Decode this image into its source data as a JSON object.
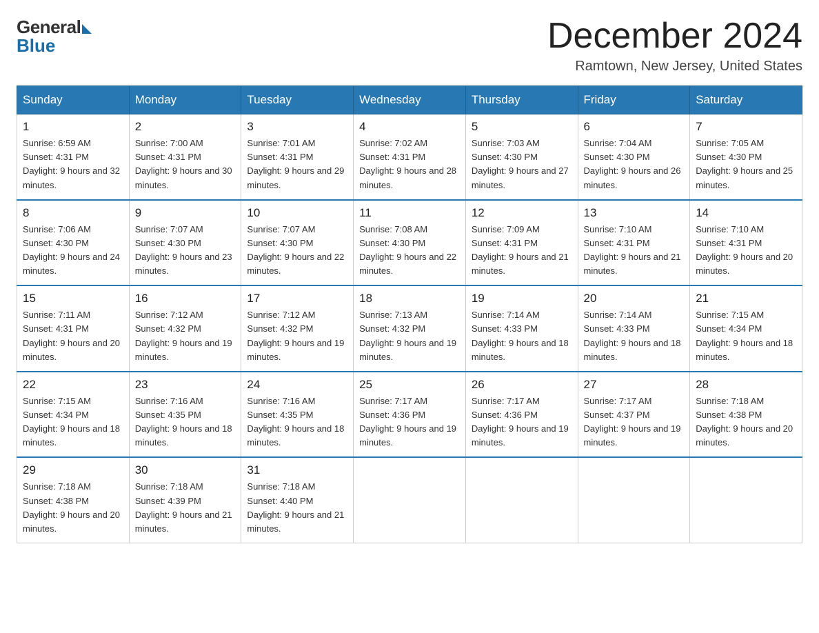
{
  "logo": {
    "general": "General",
    "blue": "Blue"
  },
  "title": "December 2024",
  "subtitle": "Ramtown, New Jersey, United States",
  "days_of_week": [
    "Sunday",
    "Monday",
    "Tuesday",
    "Wednesday",
    "Thursday",
    "Friday",
    "Saturday"
  ],
  "weeks": [
    [
      {
        "num": "1",
        "sunrise": "6:59 AM",
        "sunset": "4:31 PM",
        "daylight": "9 hours and 32 minutes."
      },
      {
        "num": "2",
        "sunrise": "7:00 AM",
        "sunset": "4:31 PM",
        "daylight": "9 hours and 30 minutes."
      },
      {
        "num": "3",
        "sunrise": "7:01 AM",
        "sunset": "4:31 PM",
        "daylight": "9 hours and 29 minutes."
      },
      {
        "num": "4",
        "sunrise": "7:02 AM",
        "sunset": "4:31 PM",
        "daylight": "9 hours and 28 minutes."
      },
      {
        "num": "5",
        "sunrise": "7:03 AM",
        "sunset": "4:30 PM",
        "daylight": "9 hours and 27 minutes."
      },
      {
        "num": "6",
        "sunrise": "7:04 AM",
        "sunset": "4:30 PM",
        "daylight": "9 hours and 26 minutes."
      },
      {
        "num": "7",
        "sunrise": "7:05 AM",
        "sunset": "4:30 PM",
        "daylight": "9 hours and 25 minutes."
      }
    ],
    [
      {
        "num": "8",
        "sunrise": "7:06 AM",
        "sunset": "4:30 PM",
        "daylight": "9 hours and 24 minutes."
      },
      {
        "num": "9",
        "sunrise": "7:07 AM",
        "sunset": "4:30 PM",
        "daylight": "9 hours and 23 minutes."
      },
      {
        "num": "10",
        "sunrise": "7:07 AM",
        "sunset": "4:30 PM",
        "daylight": "9 hours and 22 minutes."
      },
      {
        "num": "11",
        "sunrise": "7:08 AM",
        "sunset": "4:30 PM",
        "daylight": "9 hours and 22 minutes."
      },
      {
        "num": "12",
        "sunrise": "7:09 AM",
        "sunset": "4:31 PM",
        "daylight": "9 hours and 21 minutes."
      },
      {
        "num": "13",
        "sunrise": "7:10 AM",
        "sunset": "4:31 PM",
        "daylight": "9 hours and 21 minutes."
      },
      {
        "num": "14",
        "sunrise": "7:10 AM",
        "sunset": "4:31 PM",
        "daylight": "9 hours and 20 minutes."
      }
    ],
    [
      {
        "num": "15",
        "sunrise": "7:11 AM",
        "sunset": "4:31 PM",
        "daylight": "9 hours and 20 minutes."
      },
      {
        "num": "16",
        "sunrise": "7:12 AM",
        "sunset": "4:32 PM",
        "daylight": "9 hours and 19 minutes."
      },
      {
        "num": "17",
        "sunrise": "7:12 AM",
        "sunset": "4:32 PM",
        "daylight": "9 hours and 19 minutes."
      },
      {
        "num": "18",
        "sunrise": "7:13 AM",
        "sunset": "4:32 PM",
        "daylight": "9 hours and 19 minutes."
      },
      {
        "num": "19",
        "sunrise": "7:14 AM",
        "sunset": "4:33 PM",
        "daylight": "9 hours and 18 minutes."
      },
      {
        "num": "20",
        "sunrise": "7:14 AM",
        "sunset": "4:33 PM",
        "daylight": "9 hours and 18 minutes."
      },
      {
        "num": "21",
        "sunrise": "7:15 AM",
        "sunset": "4:34 PM",
        "daylight": "9 hours and 18 minutes."
      }
    ],
    [
      {
        "num": "22",
        "sunrise": "7:15 AM",
        "sunset": "4:34 PM",
        "daylight": "9 hours and 18 minutes."
      },
      {
        "num": "23",
        "sunrise": "7:16 AM",
        "sunset": "4:35 PM",
        "daylight": "9 hours and 18 minutes."
      },
      {
        "num": "24",
        "sunrise": "7:16 AM",
        "sunset": "4:35 PM",
        "daylight": "9 hours and 18 minutes."
      },
      {
        "num": "25",
        "sunrise": "7:17 AM",
        "sunset": "4:36 PM",
        "daylight": "9 hours and 19 minutes."
      },
      {
        "num": "26",
        "sunrise": "7:17 AM",
        "sunset": "4:36 PM",
        "daylight": "9 hours and 19 minutes."
      },
      {
        "num": "27",
        "sunrise": "7:17 AM",
        "sunset": "4:37 PM",
        "daylight": "9 hours and 19 minutes."
      },
      {
        "num": "28",
        "sunrise": "7:18 AM",
        "sunset": "4:38 PM",
        "daylight": "9 hours and 20 minutes."
      }
    ],
    [
      {
        "num": "29",
        "sunrise": "7:18 AM",
        "sunset": "4:38 PM",
        "daylight": "9 hours and 20 minutes."
      },
      {
        "num": "30",
        "sunrise": "7:18 AM",
        "sunset": "4:39 PM",
        "daylight": "9 hours and 21 minutes."
      },
      {
        "num": "31",
        "sunrise": "7:18 AM",
        "sunset": "4:40 PM",
        "daylight": "9 hours and 21 minutes."
      },
      null,
      null,
      null,
      null
    ]
  ]
}
